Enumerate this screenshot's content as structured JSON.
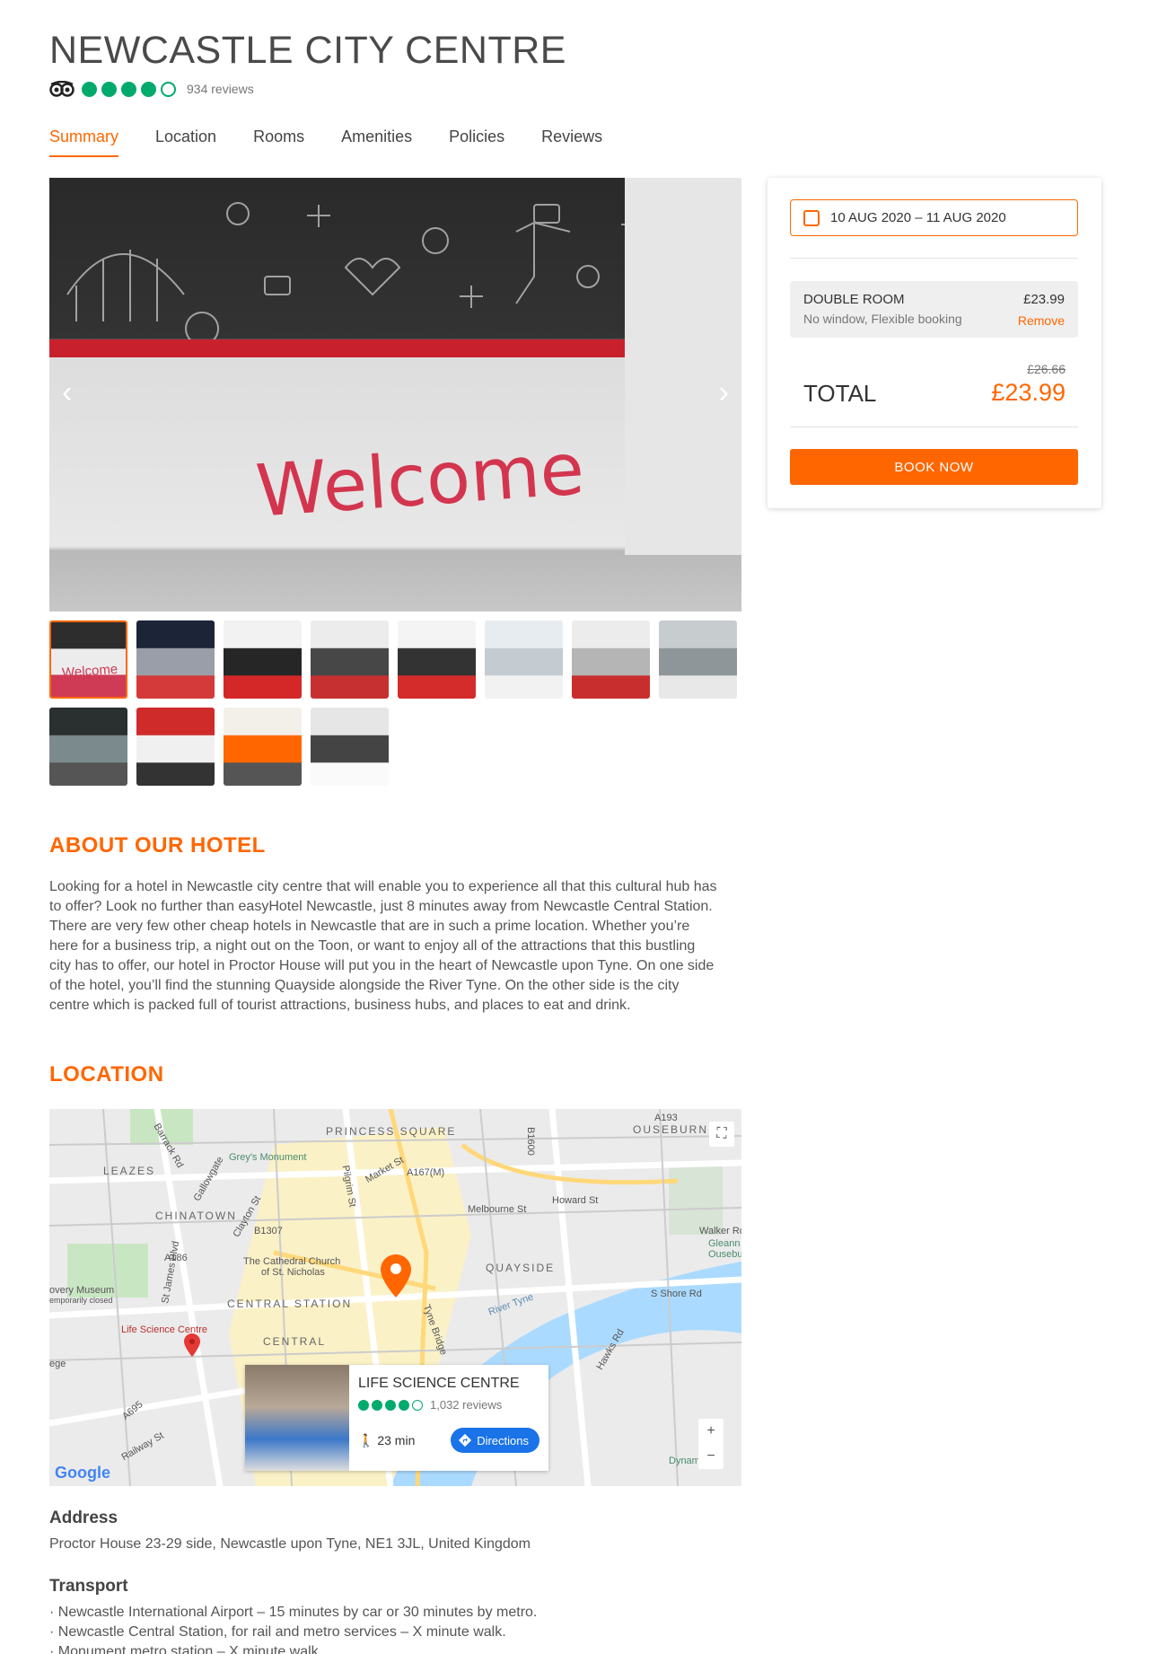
{
  "hotel": {
    "title": "NEWCASTLE CITY CENTRE",
    "rating": 4,
    "rating_max": 5,
    "review_count": "934 reviews"
  },
  "tabs": [
    {
      "label": "Summary",
      "active": true
    },
    {
      "label": "Location",
      "active": false
    },
    {
      "label": "Rooms",
      "active": false
    },
    {
      "label": "Amenities",
      "active": false
    },
    {
      "label": "Policies",
      "active": false
    },
    {
      "label": "Reviews",
      "active": false
    }
  ],
  "gallery": {
    "main_image_text": "Welcome",
    "prev_icon": "chevron-left-icon",
    "next_icon": "chevron-right-icon",
    "thumbnails": [
      {
        "text": "Welcome",
        "colors": [
          "#2d2d2d",
          "#ececec",
          "#cf3a55"
        ]
      },
      {
        "text": "",
        "colors": [
          "#1c2438",
          "#9a9ea8",
          "#d43a3a"
        ]
      },
      {
        "text": "",
        "colors": [
          "#f2f2f2",
          "#262626",
          "#d42727"
        ]
      },
      {
        "text": "",
        "colors": [
          "#ececec",
          "#474747",
          "#c73030"
        ]
      },
      {
        "text": "",
        "colors": [
          "#f4f4f4",
          "#333333",
          "#d42b2b"
        ]
      },
      {
        "text": "",
        "colors": [
          "#e6ecef",
          "#c4ccd1",
          "#f2f2f2"
        ]
      },
      {
        "text": "",
        "colors": [
          "#ececec",
          "#b5b5b5",
          "#c92e2e"
        ]
      },
      {
        "text": "",
        "colors": [
          "#c7ccce",
          "#8f9699",
          "#e8e8e8"
        ]
      },
      {
        "text": "",
        "colors": [
          "#2a2f30",
          "#7b8a8c",
          "#555555"
        ]
      },
      {
        "text": "",
        "colors": [
          "#cf2b2b",
          "#f0f0f0",
          "#333333"
        ]
      },
      {
        "text": "",
        "colors": [
          "#f3f0ea",
          "#ff6600",
          "#555555"
        ]
      },
      {
        "text": "",
        "colors": [
          "#e6e6e6",
          "#444444",
          "#fafafa"
        ]
      }
    ]
  },
  "about": {
    "title": "ABOUT OUR HOTEL",
    "lines": [
      "Looking for a hotel in Newcastle city centre that will enable you to experience all that this cultural hub has",
      "to offer? Look no further than easyHotel Newcastle, just 8 minutes away from Newcastle Central Station.",
      "There are very few other cheap hotels in Newcastle that are in such a prime location. Whether you’re",
      "here for a business trip, a night out on the Toon, or want to enjoy all of the attractions that this bustling",
      "city has to offer, our hotel in Proctor House will put you in the heart of Newcastle upon Tyne. On one side",
      "of the hotel, you’ll find the stunning Quayside alongside the River Tyne. On the other side is the city",
      "centre which is packed full of tourist attractions, business hubs, and places to eat and drink."
    ]
  },
  "location": {
    "title": "LOCATION",
    "map": {
      "districts": [
        "PRINCESS SQUARE",
        "OUSEBURN",
        "LEAZES",
        "CHINATOWN",
        "QUAYSIDE",
        "CENTRAL STATION",
        "CENTRAL"
      ],
      "places": [
        "Grey's Monument",
        "The Cathedral Church",
        "of St. Nicholas",
        "Life Science Centre",
        "overy Museum",
        "emporarily closed",
        "River Tyne",
        "Tyne Bridge",
        "Walker Rd",
        "Gleann",
        "Ouseburn",
        "ege",
        "Dynam",
        "A193",
        "A186",
        "A167(M)",
        "B1600",
        "B1307",
        "A695",
        "Railway St",
        "St James Blvd",
        "Clayton St",
        "Pilgrim St",
        "Market St",
        "Melbourne St",
        "Howard St",
        "Hawks Rd",
        "S Shore Rd",
        "Barrack Rd",
        "Gallowgate"
      ],
      "popup": {
        "title": "LIFE SCIENCE CENTRE",
        "rating": 4,
        "rating_max": 5,
        "review_count": "1,032 reviews",
        "walk_time": "23 min",
        "directions_label": "Directions"
      },
      "zoom_in": "+",
      "zoom_out": "−",
      "logo": "Google"
    }
  },
  "address": {
    "heading": "Address",
    "text": "Proctor House 23-29 side, Newcastle upon Tyne, NE1 3JL, United Kingdom"
  },
  "transport": {
    "heading": "Transport",
    "items": [
      "· Newcastle International Airport – 15 minutes by car or 30 minutes by metro.",
      "· Newcastle Central Station, for rail and metro services – X minute walk.",
      "· Monument metro station – X minute walk."
    ]
  },
  "booking": {
    "dates": "10 AUG 2020 – 11 AUG 2020",
    "room_name": "DOUBLE ROOM",
    "room_details": "No window, Flexible booking",
    "room_price": "£23.99",
    "remove_label": "Remove",
    "old_price": "£26.66",
    "total_label": "TOTAL",
    "total_price": "£23.99",
    "book_label": "BOOK NOW"
  },
  "colors": {
    "accent": "#ff6600",
    "rating_green": "#00aa6c",
    "directions_blue": "#1a73e8"
  }
}
